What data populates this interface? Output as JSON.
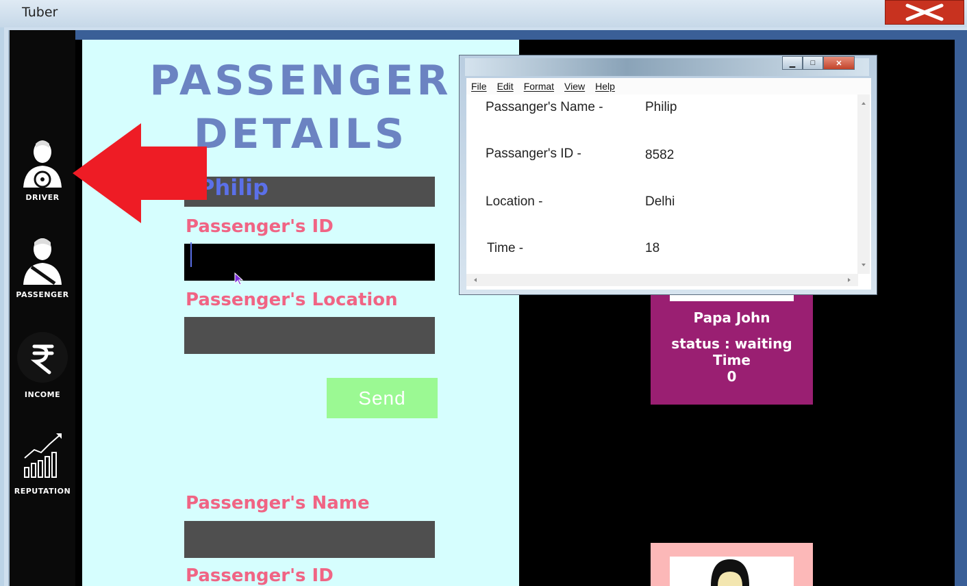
{
  "window": {
    "title": "Tuber",
    "close_glyph": "✕"
  },
  "sidebar": {
    "items": [
      {
        "label": "DRIVER",
        "icon": "driver-icon"
      },
      {
        "label": "PASSENGER",
        "icon": "passenger-icon"
      },
      {
        "label": "INCOME",
        "icon": "rupee-icon"
      },
      {
        "label": "REPUTATION",
        "icon": "chart-icon"
      }
    ]
  },
  "form": {
    "heading_line1": "PASSENGER",
    "heading_line2": "DETAILS",
    "name_value": "Philip",
    "id_label": "Passenger's ID",
    "location_label": "Passenger's Location",
    "send_label": "Send",
    "name_label_2": "Passenger's Name",
    "id_label_2": "Passenger's ID"
  },
  "card": {
    "name": "Papa John",
    "status_line": "status : waiting",
    "time_label": "Time",
    "time_value": "0"
  },
  "notepad": {
    "menu": [
      "File",
      "Edit",
      "Format",
      "View",
      "Help"
    ],
    "min_glyph": "▁",
    "max_glyph": "□",
    "close_glyph": "✕",
    "rows": [
      {
        "key": "Passanger's Name -",
        "value": "Philip"
      },
      {
        "key": "Passanger's ID -",
        "value": "8582"
      },
      {
        "key": "Location -",
        "value": "Delhi"
      },
      {
        "key": "Time  -",
        "value": "18"
      }
    ]
  },
  "colors": {
    "heading": "#6b83c2",
    "label": "#f06484",
    "card": "#9a1f72",
    "send": "#9bf993",
    "arrow": "#ee1c25"
  }
}
